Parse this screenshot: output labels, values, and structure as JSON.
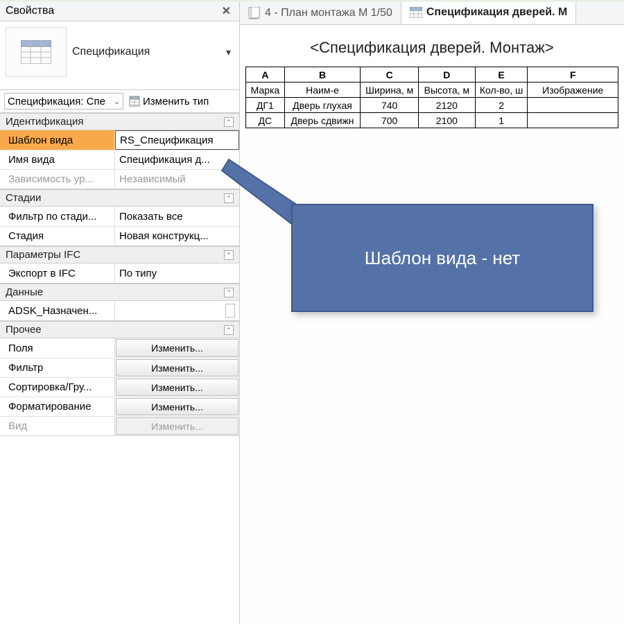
{
  "panel": {
    "title": "Свойства",
    "close_symbol": "✕",
    "type_label": "Спецификация",
    "selector_value": "Спецификация: Спе",
    "edit_type_label": "Изменить тип"
  },
  "groups": {
    "ident": {
      "label": "Идентификация",
      "rows": {
        "tmpl": {
          "name": "Шаблон вида",
          "value": "RS_Спецификация"
        },
        "vname": {
          "name": "Имя вида",
          "value": "Спецификация д..."
        },
        "dep": {
          "name": "Зависимость ур...",
          "value": "Независимый"
        }
      }
    },
    "stages": {
      "label": "Стадии",
      "rows": {
        "filter": {
          "name": "Фильтр по стади...",
          "value": "Показать все"
        },
        "stage": {
          "name": "Стадия",
          "value": "Новая конструкц..."
        }
      }
    },
    "ifc": {
      "label": "Параметры IFC",
      "rows": {
        "export": {
          "name": "Экспорт в IFC",
          "value": "По типу"
        }
      }
    },
    "data": {
      "label": "Данные",
      "rows": {
        "adsk": {
          "name": "ADSK_Назначен...",
          "value": ""
        }
      }
    },
    "other": {
      "label": "Прочее",
      "rows": {
        "fields": {
          "name": "Поля",
          "value": "Изменить..."
        },
        "filter": {
          "name": "Фильтр",
          "value": "Изменить..."
        },
        "sort": {
          "name": "Сортировка/Гру...",
          "value": "Изменить..."
        },
        "format": {
          "name": "Форматирование",
          "value": "Изменить..."
        },
        "view": {
          "name": "Вид",
          "value": "Изменить..."
        }
      }
    }
  },
  "tabs": {
    "t1": "4 - План монтажа М 1/50",
    "t2": "Спецификация дверей. М"
  },
  "schedule": {
    "title": "<Спецификация дверей. Монтаж>",
    "col_letters": [
      "A",
      "B",
      "C",
      "D",
      "E",
      "F"
    ],
    "headers": [
      "Марка",
      "Наим-е",
      "Ширина, м",
      "Высота, м",
      "Кол-во, ш",
      "Изображение"
    ],
    "rows": [
      [
        "ДГ1",
        "Дверь глухая",
        "740",
        "2120",
        "2",
        ""
      ],
      [
        "ДС",
        "Дверь сдвижн",
        "700",
        "2100",
        "1",
        ""
      ]
    ]
  },
  "callout": {
    "text": "Шаблон вида - нет"
  },
  "collapse_symbol": "⌃"
}
